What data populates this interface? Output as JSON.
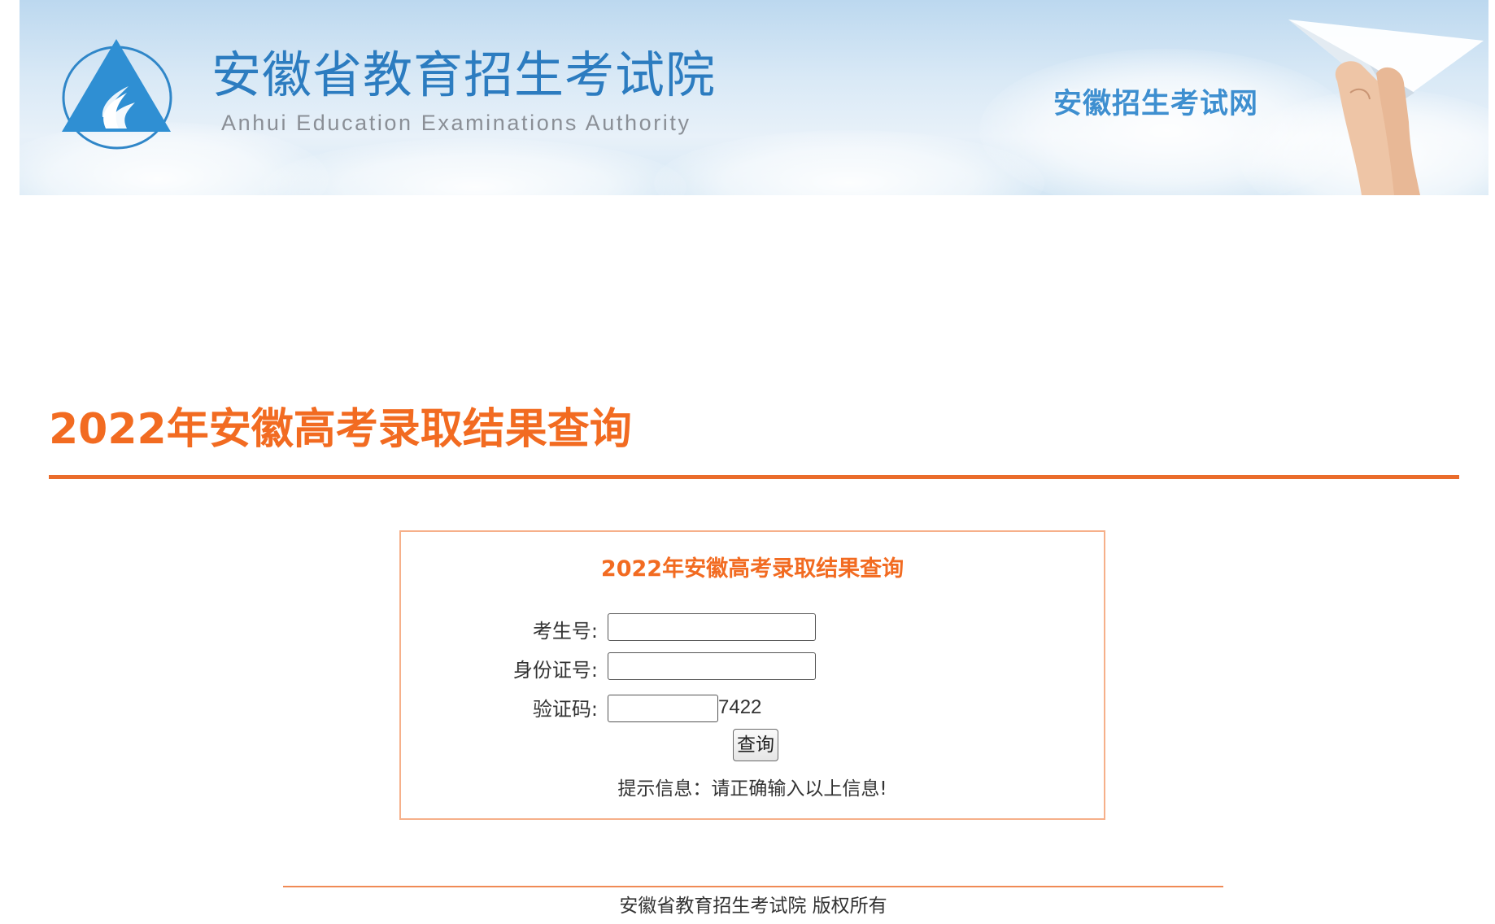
{
  "header": {
    "institution_cn": "安徽省教育招生考试院",
    "institution_en": "Anhui Education Examinations Authority",
    "site_name": "安徽招生考试网",
    "logo_icon": "triangle-flame-logo-icon",
    "decoration_icon": "hand-paper-plane-icon"
  },
  "page": {
    "title": "2022年安徽高考录取结果查询"
  },
  "form": {
    "title": "2022年安徽高考录取结果查询",
    "exam_number_label": "考生号:",
    "exam_number_value": "",
    "id_number_label": "身份证号:",
    "id_number_value": "",
    "captcha_label": "验证码:",
    "captcha_value": "",
    "captcha_code": "7422",
    "submit_label": "查询",
    "hint": "提示信息：请正确输入以上信息!"
  },
  "footer": {
    "copyright": "安徽省教育招生考试院 版权所有"
  },
  "colors": {
    "accent": "#f26b21",
    "rule": "#ea6c2b",
    "box_border": "#f6b08a",
    "brand_blue": "#2c7cc0"
  }
}
